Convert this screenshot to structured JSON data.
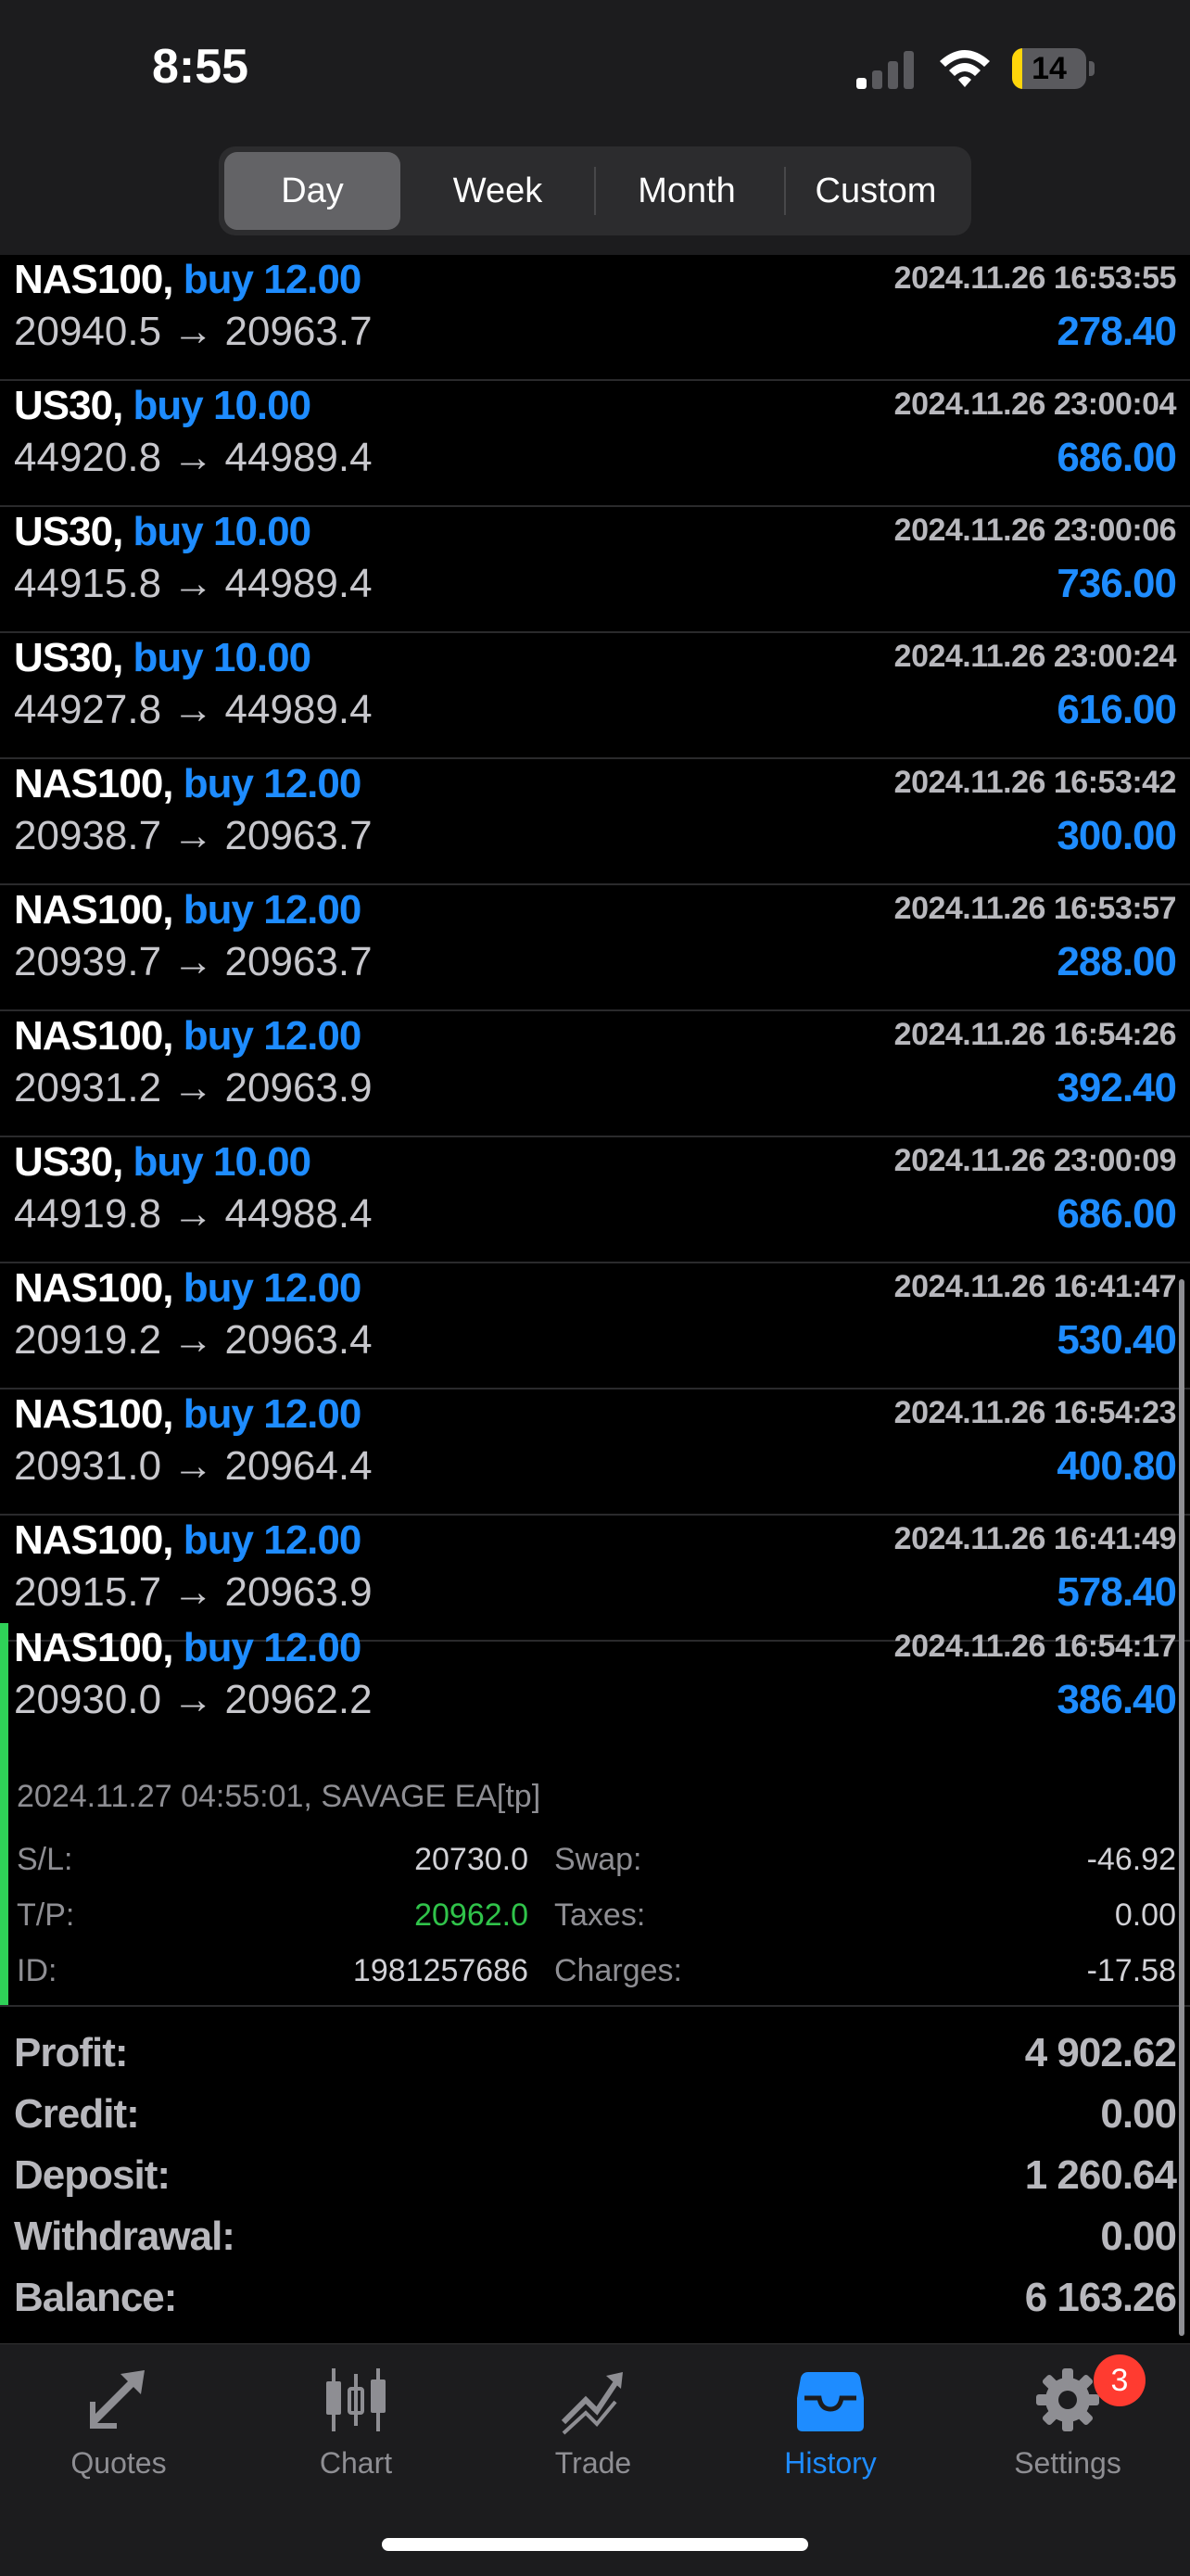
{
  "status_bar": {
    "time": "8:55",
    "battery": "14",
    "battery_level": 0.14
  },
  "segments": [
    "Day",
    "Week",
    "Month",
    "Custom"
  ],
  "active_segment": "Day",
  "deals": [
    {
      "symbol": "NAS100,",
      "side": "buy 12.00",
      "open": "20940.5",
      "close": "20963.7",
      "arrow": "→",
      "time": "2024.11.26 16:53:55",
      "profit": "278.40"
    },
    {
      "symbol": "US30,",
      "side": "buy 10.00",
      "open": "44920.8",
      "close": "44989.4",
      "arrow": "→",
      "time": "2024.11.26 23:00:04",
      "profit": "686.00"
    },
    {
      "symbol": "US30,",
      "side": "buy 10.00",
      "open": "44915.8",
      "close": "44989.4",
      "arrow": "→",
      "time": "2024.11.26 23:00:06",
      "profit": "736.00"
    },
    {
      "symbol": "US30,",
      "side": "buy 10.00",
      "open": "44927.8",
      "close": "44989.4",
      "arrow": "→",
      "time": "2024.11.26 23:00:24",
      "profit": "616.00"
    },
    {
      "symbol": "NAS100,",
      "side": "buy 12.00",
      "open": "20938.7",
      "close": "20963.7",
      "arrow": "→",
      "time": "2024.11.26 16:53:42",
      "profit": "300.00"
    },
    {
      "symbol": "NAS100,",
      "side": "buy 12.00",
      "open": "20939.7",
      "close": "20963.7",
      "arrow": "→",
      "time": "2024.11.26 16:53:57",
      "profit": "288.00"
    },
    {
      "symbol": "NAS100,",
      "side": "buy 12.00",
      "open": "20931.2",
      "close": "20963.9",
      "arrow": "→",
      "time": "2024.11.26 16:54:26",
      "profit": "392.40"
    },
    {
      "symbol": "US30,",
      "side": "buy 10.00",
      "open": "44919.8",
      "close": "44988.4",
      "arrow": "→",
      "time": "2024.11.26 23:00:09",
      "profit": "686.00"
    },
    {
      "symbol": "NAS100,",
      "side": "buy 12.00",
      "open": "20919.2",
      "close": "20963.4",
      "arrow": "→",
      "time": "2024.11.26 16:41:47",
      "profit": "530.40"
    },
    {
      "symbol": "NAS100,",
      "side": "buy 12.00",
      "open": "20931.0",
      "close": "20964.4",
      "arrow": "→",
      "time": "2024.11.26 16:54:23",
      "profit": "400.80"
    },
    {
      "symbol": "NAS100,",
      "side": "buy 12.00",
      "open": "20915.7",
      "close": "20963.9",
      "arrow": "→",
      "time": "2024.11.26 16:41:49",
      "profit": "578.40"
    }
  ],
  "expanded_deal": {
    "symbol": "NAS100,",
    "side": "buy 12.00",
    "open": "20930.0",
    "close": "20962.2",
    "arrow": "→",
    "time": "2024.11.26 16:54:17",
    "profit": "386.40",
    "comment": "2024.11.27 04:55:01, SAVAGE EA[tp]",
    "sl_label": "S/L:",
    "sl": "20730.0",
    "tp_label": "T/P:",
    "tp": "20962.0",
    "id_label": "ID:",
    "id": "1981257686",
    "swap_label": "Swap:",
    "swap": "-46.92",
    "taxes_label": "Taxes:",
    "taxes": "0.00",
    "charges_label": "Charges:",
    "charges": "-17.58"
  },
  "summary": [
    {
      "label": "Profit:",
      "value": "4 902.62"
    },
    {
      "label": "Credit:",
      "value": "0.00"
    },
    {
      "label": "Deposit:",
      "value": "1 260.64"
    },
    {
      "label": "Withdrawal:",
      "value": "0.00"
    },
    {
      "label": "Balance:",
      "value": "6 163.26"
    }
  ],
  "tabs": [
    {
      "label": "Quotes",
      "icon": "quotes-icon"
    },
    {
      "label": "Chart",
      "icon": "chart-icon"
    },
    {
      "label": "Trade",
      "icon": "trade-icon"
    },
    {
      "label": "History",
      "icon": "history-icon"
    },
    {
      "label": "Settings",
      "icon": "gear-icon"
    }
  ],
  "active_tab": "History",
  "settings_badge": "3",
  "colors": {
    "accent": "#1e8cff",
    "tp_green": "#30c34a",
    "selected_bar": "#2fd158",
    "badge": "#ff3b30"
  }
}
